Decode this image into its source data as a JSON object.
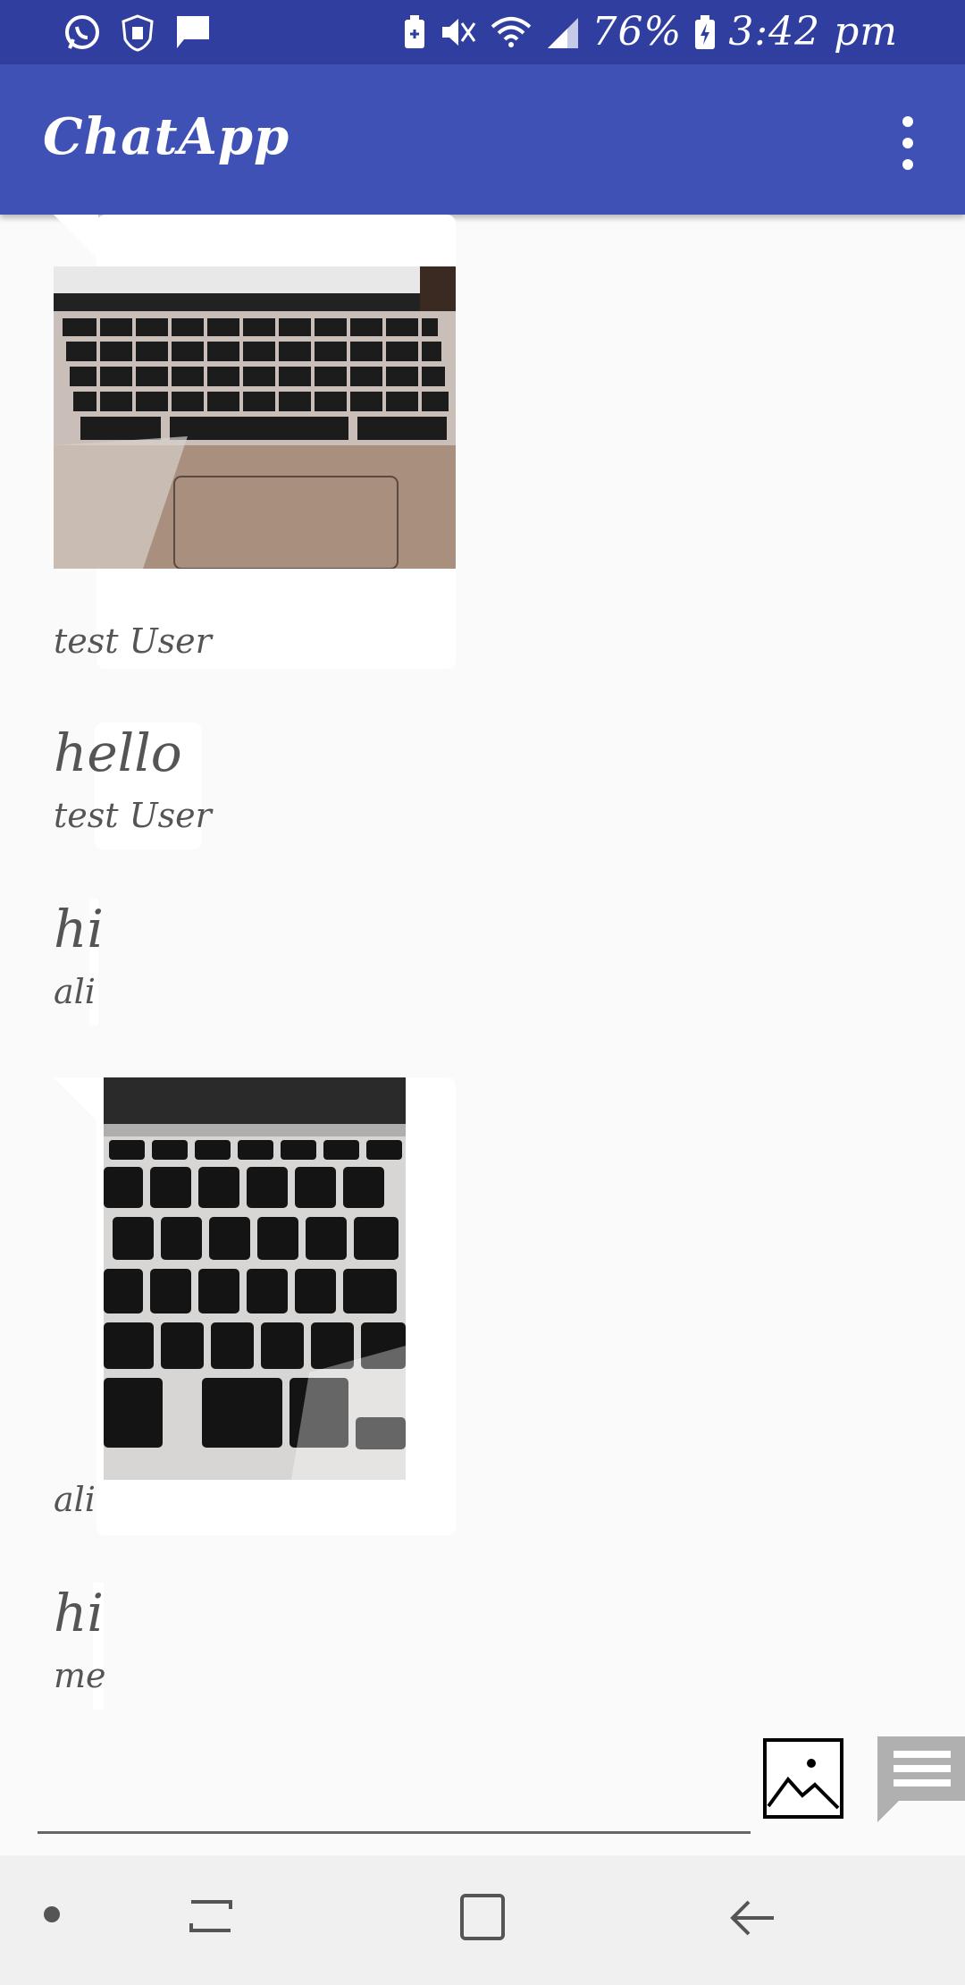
{
  "status_bar": {
    "battery": "76%",
    "time": "3:42 pm",
    "left_icons": [
      "whatsapp-icon",
      "shield-hand-icon",
      "message-icon"
    ],
    "right_icons": [
      "battery-saver-icon",
      "mute-icon",
      "wifi-icon",
      "signal-icon",
      "charging-battery-icon"
    ]
  },
  "app_bar": {
    "title": "ChatApp",
    "menu_icon": "more-vert-icon"
  },
  "messages": [
    {
      "type": "image",
      "sender": "test User",
      "image": "laptop-keyboard-photo"
    },
    {
      "type": "text",
      "text": "hello",
      "sender": "test User"
    },
    {
      "type": "text",
      "text": "hi",
      "sender": "ali"
    },
    {
      "type": "image",
      "sender": "ali",
      "image": "keyboard-closeup-photo"
    },
    {
      "type": "text",
      "text": "hi",
      "sender": "me"
    }
  ],
  "composer": {
    "input_value": "",
    "image_button_icon": "image-icon",
    "send_button_icon": "chat-icon"
  },
  "nav_bar": {
    "icons": [
      "dot-icon",
      "recent-apps-icon",
      "home-icon",
      "back-icon"
    ]
  },
  "colors": {
    "status_bar": "#303f9f",
    "app_bar": "#3f51b5",
    "background": "#fafafa"
  }
}
